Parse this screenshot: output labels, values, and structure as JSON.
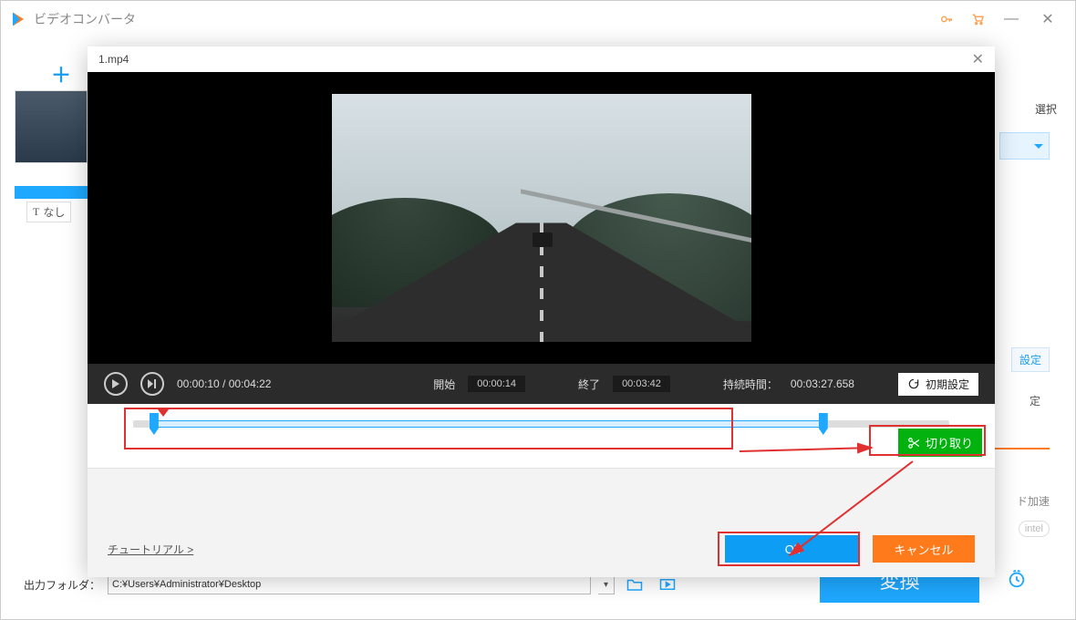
{
  "app": {
    "title": "ビデオコンバータ"
  },
  "background": {
    "add_prefix": "＋ ",
    "subtitle_none": "なし",
    "select_label": "選択",
    "settings_label": "設定",
    "fixed_label": "定",
    "hw_accel": "ド加速",
    "intel_label": "intel",
    "output_folder_label": "出力フォルダ：",
    "output_path": "C:¥Users¥Administrator¥Desktop",
    "convert_label": "変換"
  },
  "modal": {
    "filename": "1.mp4",
    "playback": {
      "current": "00:00:10",
      "total": "00:04:22",
      "separator": " / "
    },
    "start_label": "開始",
    "start_value": "00:00:14",
    "end_label": "終了",
    "end_value": "00:03:42",
    "duration_label": "持続時間：",
    "duration_value": "00:03:27.658",
    "reset_label": "初期設定",
    "cut_label": "切り取り",
    "tutorial_label": "チュートリアル >",
    "ok_label": "Ok",
    "cancel_label": "キャンセル"
  },
  "timeline": {
    "range_left_pct": 2,
    "range_right_pct": 85,
    "marker_pct": 3
  }
}
